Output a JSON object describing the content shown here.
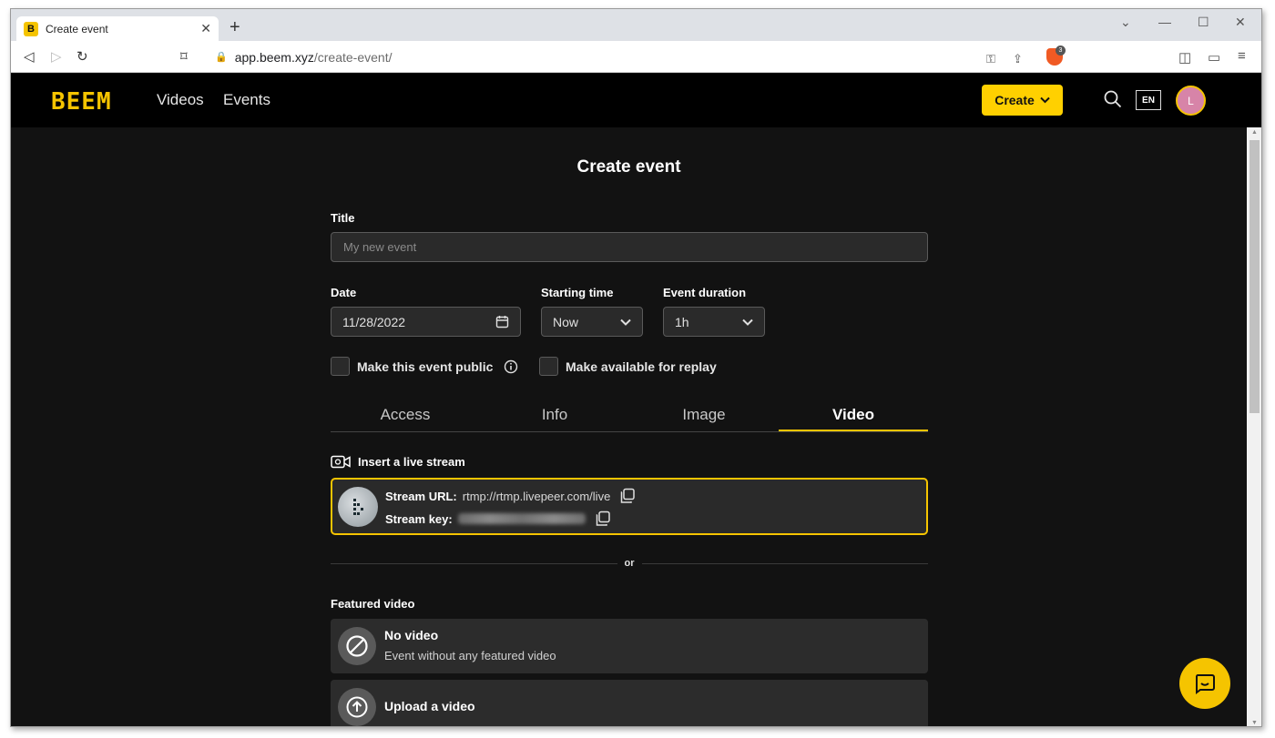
{
  "browser": {
    "tab_title": "Create event",
    "favicon_letter": "B",
    "url_host": "app.beem.xyz",
    "url_path": "/create-event/",
    "brave_badge": "3"
  },
  "header": {
    "logo": "BEEM",
    "nav": [
      "Videos",
      "Events"
    ],
    "create_label": "Create",
    "lang": "EN",
    "avatar_initial": "L",
    "accent": "#ffd000"
  },
  "form": {
    "page_title": "Create event",
    "title_label": "Title",
    "title_placeholder": "My new event",
    "date_label": "Date",
    "date_value": "11/28/2022",
    "start_label": "Starting time",
    "start_value": "Now",
    "duration_label": "Event duration",
    "duration_value": "1h",
    "public_label": "Make this event public",
    "replay_label": "Make available for replay",
    "tabs": [
      "Access",
      "Info",
      "Image",
      "Video"
    ],
    "active_tab": "Video",
    "live_stream_heading": "Insert a live stream",
    "stream_url_label": "Stream URL:",
    "stream_url_value": "rtmp://rtmp.livepeer.com/live",
    "stream_key_label": "Stream key:",
    "or_text": "or",
    "featured_label": "Featured video",
    "no_video_title": "No video",
    "no_video_sub": "Event without any featured video",
    "upload_title": "Upload a video"
  }
}
